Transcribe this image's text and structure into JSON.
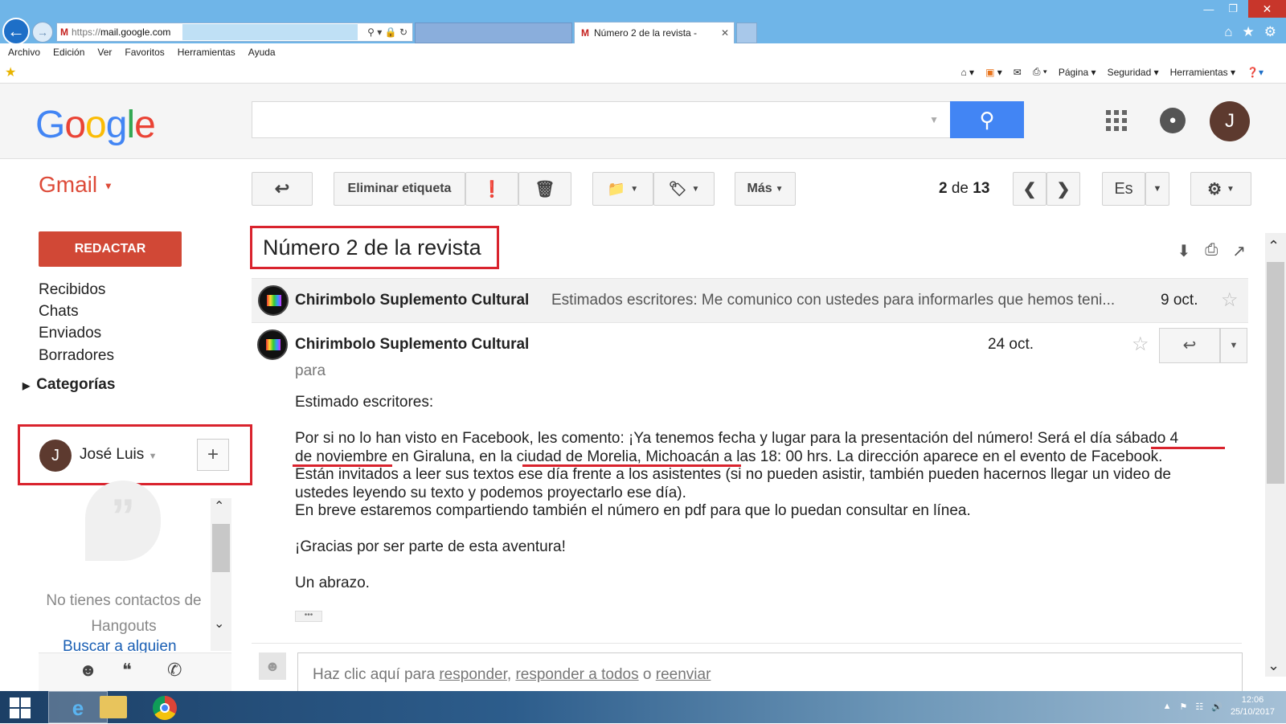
{
  "browser": {
    "address_prefix": "https://",
    "address_host": "mail.google.com",
    "active_tab_title": "Número 2 de la revista -",
    "menu": [
      "Archivo",
      "Edición",
      "Ver",
      "Favoritos",
      "Herramientas",
      "Ayuda"
    ],
    "cmd": {
      "page": "Página ▾",
      "security": "Seguridad ▾",
      "tools": "Herramientas ▾"
    }
  },
  "header": {
    "account_initial": "J"
  },
  "toolbar": {
    "gmail_label": "Gmail",
    "remove_label": "Eliminar etiqueta",
    "more": "Más",
    "pager_pos": "2",
    "pager_of": "de",
    "pager_total": "13",
    "lang": "Es"
  },
  "sidebar": {
    "compose": "REDACTAR",
    "items": [
      "Recibidos",
      "Chats",
      "Enviados",
      "Borradores"
    ],
    "categories": "Categorías"
  },
  "hangouts": {
    "user_initial": "J",
    "user_name": "José Luis",
    "empty_line1": "No tienes contactos de",
    "empty_line2": "Hangouts",
    "search": "Buscar a alguien"
  },
  "thread": {
    "subject": "Número 2 de la revista",
    "collapsed": {
      "sender": "Chirimbolo Suplemento Cultural",
      "snippet": "Estimados escritores: Me comunico con ustedes para informarles que hemos teni...",
      "date": "9 oct."
    },
    "message": {
      "sender": "Chirimbolo Suplemento Cultural",
      "date": "24 oct.",
      "to": "para",
      "greeting": "Estimado escritores:",
      "p1_l1": "Por si no lo han visto en Facebook, les comento: ¡Ya tenemos fecha y lugar para la presentación del número! Será el día sábado 4",
      "p1_l2": "de noviembre en Giraluna, en la ciudad de Morelia, Michoacán a las 18: 00 hrs. La dirección aparece en el evento de Facebook.",
      "p1_l3": "Están invitados a leer sus textos ese día frente a los asistentes (si no pueden asistir, también pueden hacernos llegar un video de",
      "p1_l4": "ustedes leyendo su texto y podemos proyectarlo ese día).",
      "p1_l5": "En breve estaremos compartiendo también el número en pdf para que lo puedan consultar en línea.",
      "thanks": "¡Gracias por ser parte de esta aventura!",
      "closing": "Un abrazo."
    },
    "reply": {
      "prefix": "Haz clic aquí para",
      "reply": "responder",
      "comma": ",",
      "reply_all": "responder a todos",
      "or": "o",
      "forward": "reenviar"
    }
  },
  "taskbar": {
    "time": "12:06",
    "date": "25/10/2017"
  }
}
